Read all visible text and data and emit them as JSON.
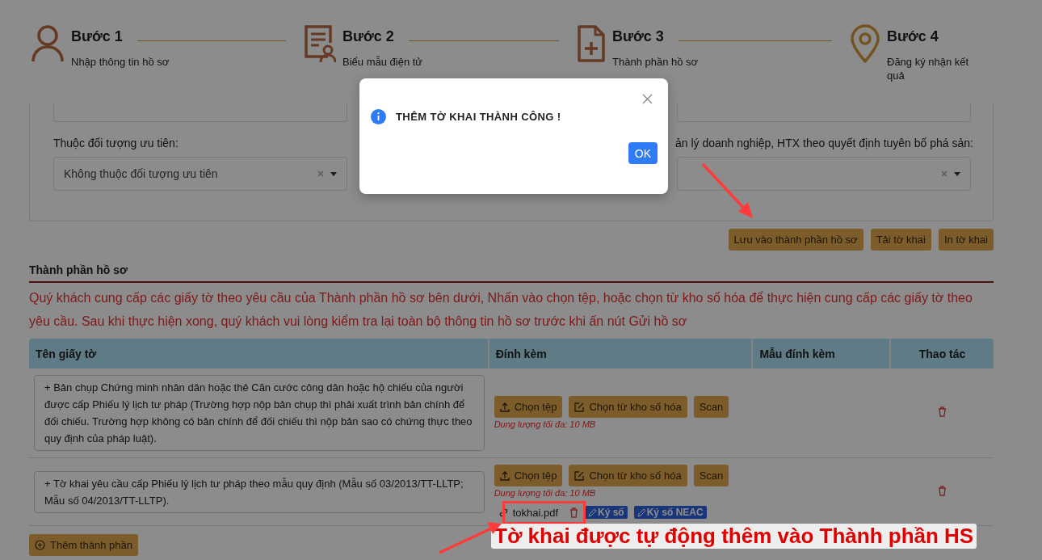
{
  "steps": [
    {
      "title": "Bước 1",
      "subtitle": "Nhập thông tin hồ sơ"
    },
    {
      "title": "Bước 2",
      "subtitle": "Biểu mẫu điện tử"
    },
    {
      "title": "Bước 3",
      "subtitle": "Thành phần hồ sơ"
    },
    {
      "title": "Bước 4",
      "subtitle": "Đăng ký nhận kết quả"
    }
  ],
  "form": {
    "fields": [
      {
        "label": "Thuộc đối tượng ưu tiên:",
        "value": "Không thuộc đối tượng ưu tiên"
      },
      {
        "label": "ản lý doanh nghiệp, HTX theo quyết định tuyên bố phá sản:"
      }
    ],
    "actions": [
      "Lưu vào thành phần hồ sơ",
      "Tải tờ khai",
      "In tờ khai"
    ]
  },
  "documents": {
    "title": "Thành phần hồ sơ",
    "notice": "Quý khách cung cấp các giấy tờ theo yêu cầu của Thành phần hồ sơ bên dưới, Nhấn vào chọn tệp, hoặc chọn từ kho số hóa để thực hiện cung cấp các giấy tờ theo yêu cầu. Sau khi thực hiện xong, quý khách vui lòng kiểm tra lại toàn bộ thông tin hồ sơ trước khi ấn nút Gửi hồ sơ",
    "columns": [
      "Tên giấy tờ",
      "Đính kèm",
      "Mẫu đính kèm",
      "Thao tác"
    ],
    "rows": [
      {
        "name": "+ Bản chụp Chứng minh nhân dân hoặc thẻ Căn cước công dân hoặc hộ chiếu của người được cấp Phiếu lý lịch tư pháp (Trường hợp nộp bản chụp thì phải xuất trình bản chính để đối chiếu. Trường hợp không có bản chính để đối chiếu thì nộp bản sao có chứng thực theo quy định của pháp luật).",
        "actions": [
          "Chọn tệp",
          "Chọn từ kho số hóa",
          "Scan"
        ],
        "size_note": "Dung lượng tối đa: 10 MB"
      },
      {
        "name": "+ Tờ khai yêu cầu cấp Phiếu lý lịch tư pháp theo mẫu quy định (Mẫu số 03/2013/TT-LLTP; Mẫu số 04/2013/TT-LLTP).",
        "actions": [
          "Chọn tệp",
          "Chọn từ kho số hóa",
          "Scan"
        ],
        "size_note": "Dung lượng tối đa: 10 MB",
        "attachment": {
          "file": "tokhai.pdf",
          "sign_buttons": [
            "Ký số",
            "Ký số NEAC"
          ]
        }
      }
    ],
    "add_button": "Thêm thành phần"
  },
  "dialog": {
    "message": "THÊM TỜ KHAI THÀNH CÔNG !",
    "ok": "OK"
  },
  "annotation": {
    "text": "Tờ khai được tự động thêm vào Thành phần HS"
  }
}
